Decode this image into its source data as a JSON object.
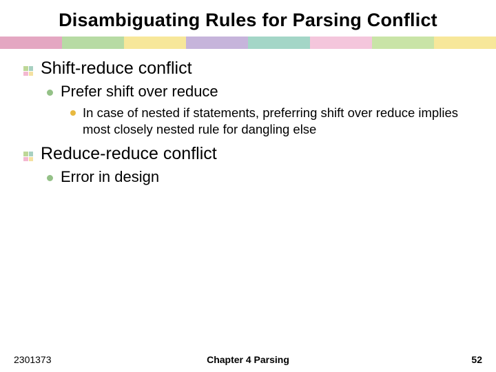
{
  "title": "Disambiguating Rules for Parsing Conflict",
  "divider_colors": [
    "#e4a7c2",
    "#b7dba4",
    "#f7e79a",
    "#c6b4db",
    "#a4d6c7",
    "#f4c6dc",
    "#c9e4a7",
    "#f7e79a"
  ],
  "sections": [
    {
      "heading": "Shift-reduce conflict",
      "items": [
        {
          "text": "Prefer shift over reduce",
          "sub": [
            {
              "text": "In case of nested if statements, preferring shift over reduce implies most closely nested rule for dangling else"
            }
          ]
        }
      ]
    },
    {
      "heading": "Reduce-reduce conflict",
      "items": [
        {
          "text": "Error in design",
          "sub": []
        }
      ]
    }
  ],
  "footer": {
    "left": "2301373",
    "center": "Chapter 4   Parsing",
    "right": "52"
  }
}
